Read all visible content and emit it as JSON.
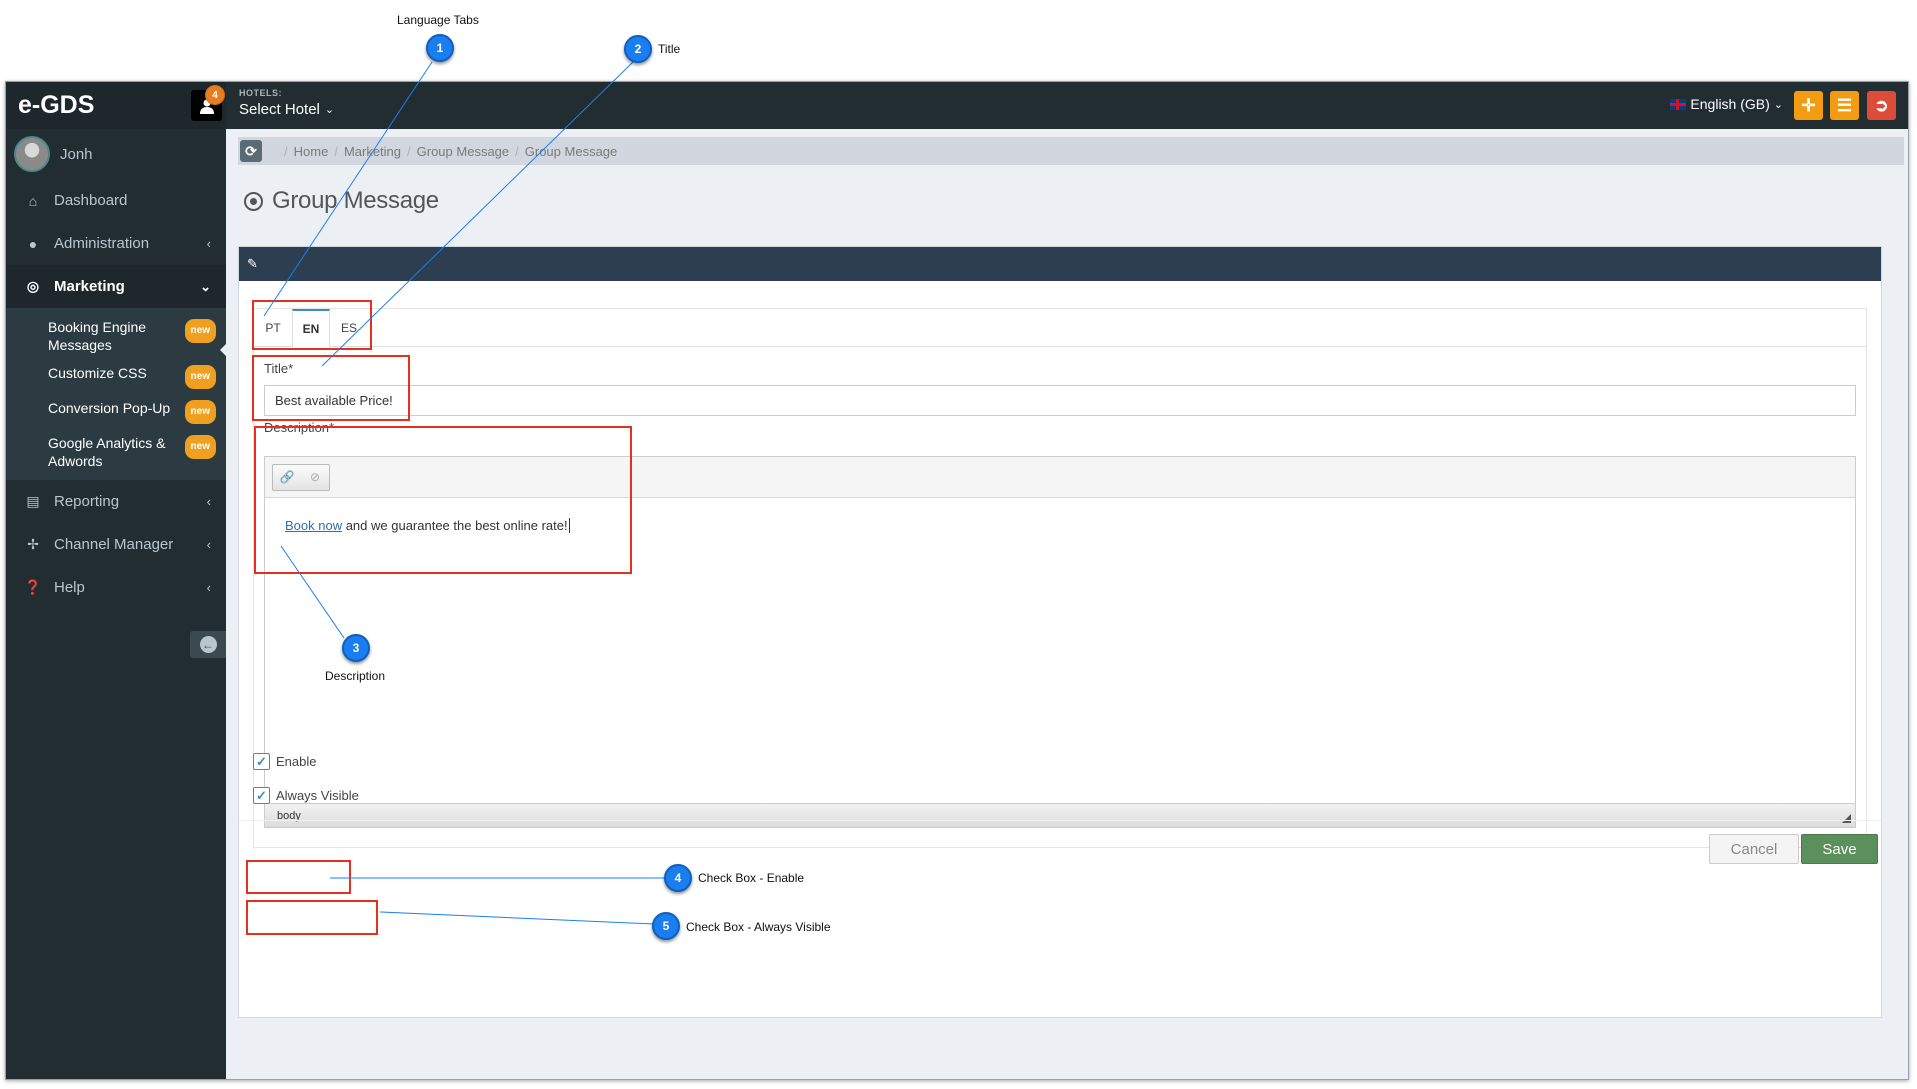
{
  "topbar": {
    "brand": "e-GDS",
    "user_badge": "4",
    "hotel_label": "HOTELS:",
    "hotel_select": "Select Hotel",
    "language": "English (GB)"
  },
  "sidebar": {
    "user_name": "Jonh",
    "items": [
      {
        "label": "Dashboard",
        "icon": "home-icon"
      },
      {
        "label": "Administration",
        "icon": "user-icon"
      },
      {
        "label": "Marketing",
        "icon": "target-icon"
      },
      {
        "label": "Reporting",
        "icon": "bar-chart-icon"
      },
      {
        "label": "Channel Manager",
        "icon": "arrows-icon"
      },
      {
        "label": "Help",
        "icon": "question-icon"
      }
    ],
    "submenu": [
      {
        "label": "Booking Engine Messages",
        "badge": "new"
      },
      {
        "label": "Customize CSS",
        "badge": "new"
      },
      {
        "label": "Conversion Pop-Up",
        "badge": "new"
      },
      {
        "label": "Google Analytics & Adwords",
        "badge": "new"
      }
    ]
  },
  "breadcrumb": [
    "Home",
    "Marketing",
    "Group Message",
    "Group Message"
  ],
  "page": {
    "title": "Group Message",
    "tabs": [
      "PT",
      "EN",
      "ES"
    ],
    "title_label": "Title*",
    "title_value": "Best available Price!",
    "description_label": "Description*",
    "description_link": "Book now",
    "description_rest": " and we guarantee the best online rate!",
    "editor_path": "body",
    "enable_label": "Enable",
    "always_visible_label": "Always Visible",
    "cancel_label": "Cancel",
    "save_label": "Save"
  },
  "annotations": [
    {
      "number": "1",
      "text": "Language Tabs"
    },
    {
      "number": "2",
      "text": "Title"
    },
    {
      "number": "3",
      "text": "Description"
    },
    {
      "number": "4",
      "text": "Check Box - Enable"
    },
    {
      "number": "5",
      "text": "Check Box - Always Visible"
    }
  ],
  "colors": {
    "topbar": "#222d32",
    "sidebar": "#222d32",
    "box_header": "#2c3e50",
    "badge_new": "#f0a020",
    "save_button": "#5b8f5b",
    "annotation_blue": "#1a7ef0",
    "highlight_red": "#e53020"
  }
}
